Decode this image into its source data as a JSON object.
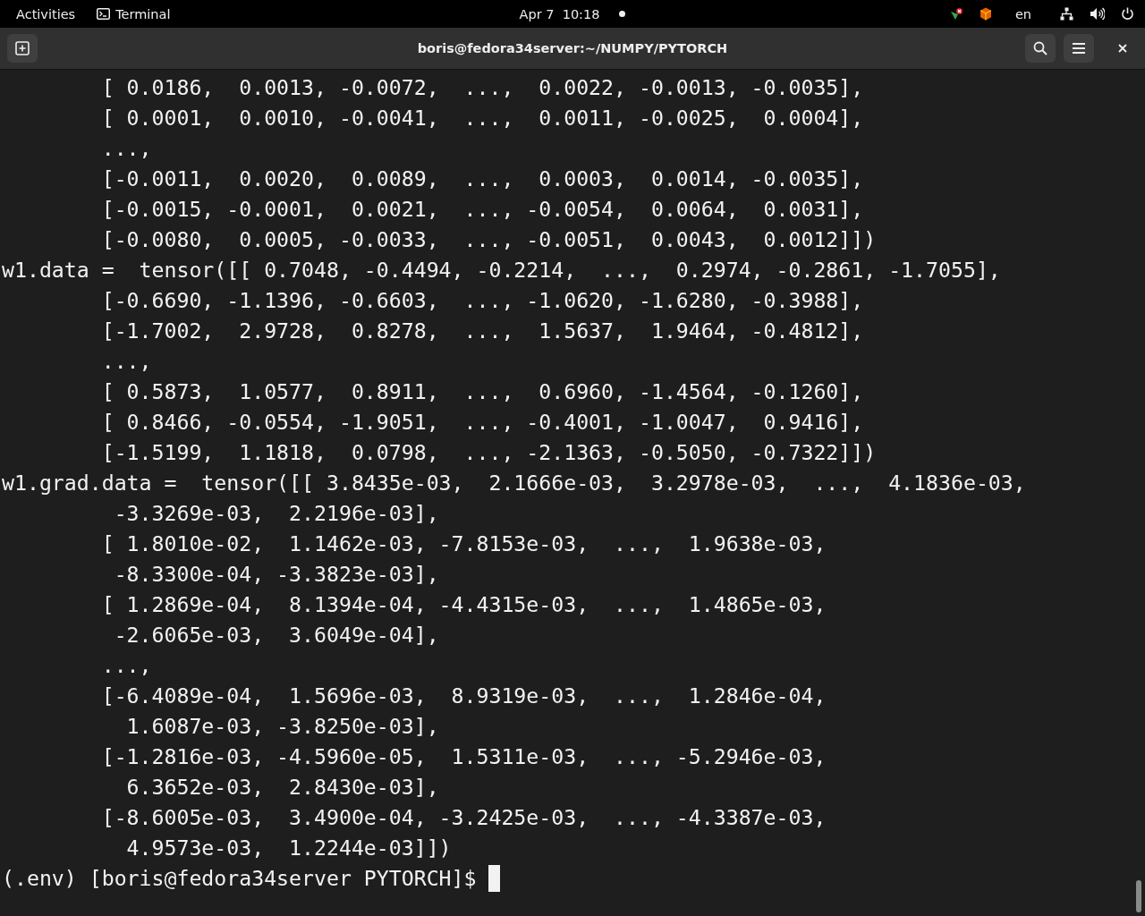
{
  "top_bar": {
    "activities": "Activities",
    "app_menu": "Terminal",
    "clock": "Apr 7  10:18",
    "notification_dot": true,
    "language": "en"
  },
  "window": {
    "title": "boris@fedora34server:~/NUMPY/PYTORCH"
  },
  "terminal": {
    "lines": [
      "        [ 0.0186,  0.0013, -0.0072,  ...,  0.0022, -0.0013, -0.0035],",
      "        [ 0.0001,  0.0010, -0.0041,  ...,  0.0011, -0.0025,  0.0004],",
      "        ...,",
      "        [-0.0011,  0.0020,  0.0089,  ...,  0.0003,  0.0014, -0.0035],",
      "        [-0.0015, -0.0001,  0.0021,  ..., -0.0054,  0.0064,  0.0031],",
      "        [-0.0080,  0.0005, -0.0033,  ..., -0.0051,  0.0043,  0.0012]])",
      "w1.data =  tensor([[ 0.7048, -0.4494, -0.2214,  ...,  0.2974, -0.2861, -1.7055],",
      "        [-0.6690, -1.1396, -0.6603,  ..., -1.0620, -1.6280, -0.3988],",
      "        [-1.7002,  2.9728,  0.8278,  ...,  1.5637,  1.9464, -0.4812],",
      "        ...,",
      "        [ 0.5873,  1.0577,  0.8911,  ...,  0.6960, -1.4564, -0.1260],",
      "        [ 0.8466, -0.0554, -1.9051,  ..., -0.4001, -1.0047,  0.9416],",
      "        [-1.5199,  1.1818,  0.0798,  ..., -2.1363, -0.5050, -0.7322]])",
      "w1.grad.data =  tensor([[ 3.8435e-03,  2.1666e-03,  3.2978e-03,  ...,  4.1836e-03,",
      "         -3.3269e-03,  2.2196e-03],",
      "        [ 1.8010e-02,  1.1462e-03, -7.8153e-03,  ...,  1.9638e-03,",
      "         -8.3300e-04, -3.3823e-03],",
      "        [ 1.2869e-04,  8.1394e-04, -4.4315e-03,  ...,  1.4865e-03,",
      "         -2.6065e-03,  3.6049e-04],",
      "        ...,",
      "        [-6.4089e-04,  1.5696e-03,  8.9319e-03,  ...,  1.2846e-04,",
      "          1.6087e-03, -3.8250e-03],",
      "        [-1.2816e-03, -4.5960e-05,  1.5311e-03,  ..., -5.2946e-03,",
      "          6.3652e-03,  2.8430e-03],",
      "        [-8.6005e-03,  3.4900e-04, -3.2425e-03,  ..., -4.3387e-03,",
      "          4.9573e-03,  1.2244e-03]])"
    ],
    "prompt": "(.env) [boris@fedora34server PYTORCH]$"
  }
}
